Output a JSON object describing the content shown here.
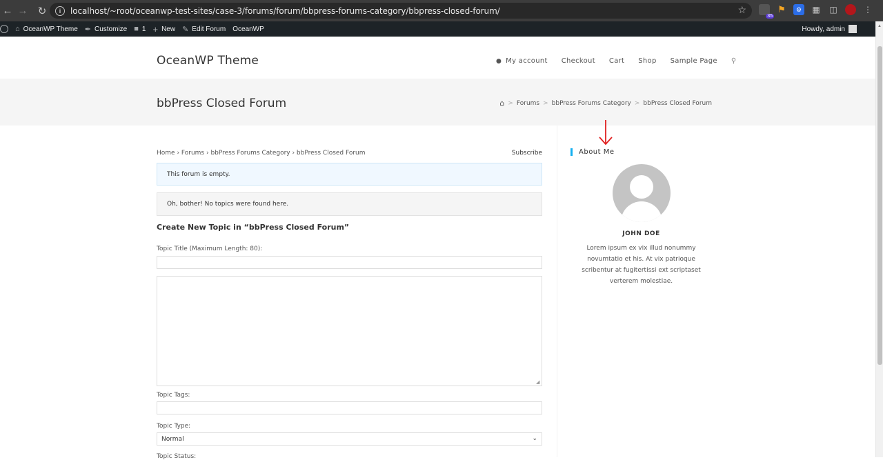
{
  "browser": {
    "url": "localhost/~root/oceanwp-test-sites/case-3/forums/forum/bbpress-forums-category/bbpress-closed-forum/",
    "badge_count": "35"
  },
  "admin_bar": {
    "site_name": "OceanWP Theme",
    "customize": "Customize",
    "comments_count": "1",
    "new": "New",
    "edit_forum": "Edit Forum",
    "theme": "OceanWP",
    "howdy": "Howdy, admin"
  },
  "header": {
    "site_title": "OceanWP Theme",
    "nav": [
      "My account",
      "Checkout",
      "Cart",
      "Shop",
      "Sample Page"
    ]
  },
  "page_header": {
    "title": "bbPress Closed Forum",
    "breadcrumbs": [
      "Forums",
      "bbPress Forums Category",
      "bbPress Closed Forum"
    ]
  },
  "content": {
    "bbp_breadcrumb": "Home › Forums › bbPress Forums Category › bbPress Closed Forum",
    "subscribe": "Subscribe",
    "notice_empty_forum": "This forum is empty.",
    "notice_no_topics": "Oh, bother! No topics were found here.",
    "form_title": "Create New Topic in “bbPress Closed Forum”",
    "topic_title_label": "Topic Title (Maximum Length: 80):",
    "topic_title_value": "",
    "topic_body_value": "",
    "topic_tags_label": "Topic Tags:",
    "topic_tags_value": "",
    "topic_type_label": "Topic Type:",
    "topic_type_value": "Normal",
    "topic_status_label": "Topic Status:"
  },
  "sidebar": {
    "widget_title": "About Me",
    "author_name": "JOHN DOE",
    "author_bio": "Lorem ipsum ex vix illud nonummy novumtatio et his. At vix patrioque scribentur at fugitertissi ext scriptaset verterem molestiae."
  },
  "colors": {
    "accent": "#13aff0",
    "annotation": "#e02020",
    "admin_bar": "#1d2327"
  }
}
